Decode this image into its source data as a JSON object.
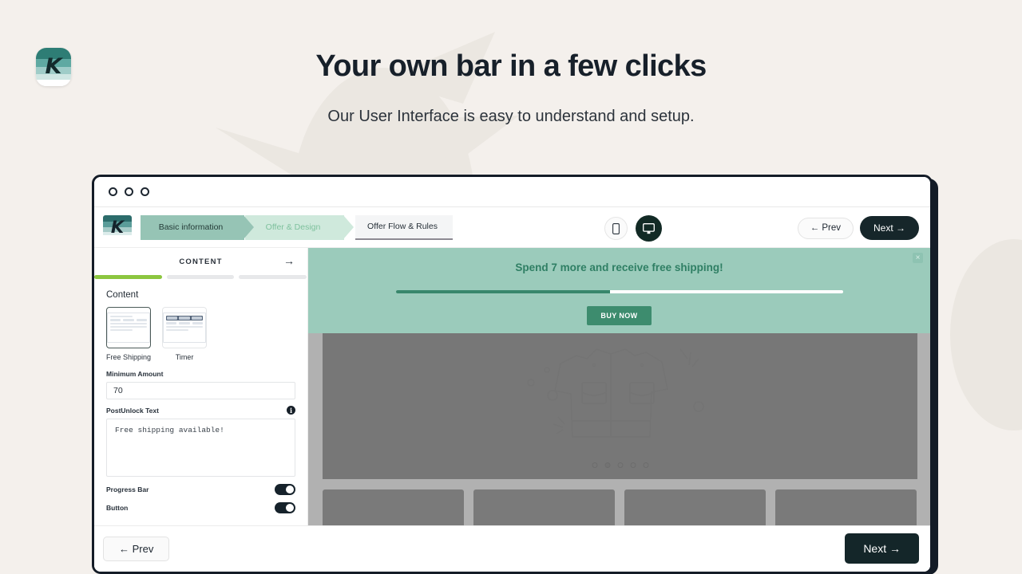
{
  "hero": {
    "title": "Your own bar in a few clicks",
    "subtitle": "Our User Interface is easy to understand and setup.",
    "logo_letter": "K",
    "logo_name": "brand-logo"
  },
  "window": {
    "titlebar_dots": 3
  },
  "toolbar": {
    "logo_letter": "K",
    "steps": [
      {
        "label": "Basic information",
        "state": "done"
      },
      {
        "label": "Offer & Design",
        "state": "active"
      },
      {
        "label": "Offer Flow & Rules",
        "state": "todo"
      }
    ],
    "devices": [
      {
        "name": "mobile",
        "selected": false
      },
      {
        "name": "desktop",
        "selected": true
      }
    ],
    "prev_label": "← Prev",
    "next_label": "Next →"
  },
  "sidebar": {
    "header": "CONTENT",
    "header_arrow": "→",
    "progress_segments": 3,
    "progress_filled": 1,
    "section_label": "Content",
    "options": [
      {
        "label": "Free Shipping",
        "selected": true
      },
      {
        "label": "Timer",
        "selected": false
      }
    ],
    "fields": [
      {
        "label": "Minimum Amount",
        "value": "70",
        "type": "input"
      },
      {
        "label": "PostUnlock Text",
        "value": "Free shipping available!",
        "type": "textarea",
        "info_icon": "i"
      }
    ],
    "toggles": [
      {
        "label": "Progress Bar",
        "on": true
      },
      {
        "label": "Button",
        "on": true
      }
    ]
  },
  "preview": {
    "promo": {
      "message": "Spend 7 more and receive free shipping!",
      "progress_percent": 48,
      "cta_label": "BUY NOW",
      "close_label": "×"
    },
    "carousel": {
      "dots": 5,
      "active_index": 1
    },
    "product_cards": 4
  },
  "footer": {
    "prev_label": "← Prev",
    "next_label": "Next →"
  },
  "colors": {
    "page_bg": "#f4f0ec",
    "dark": "#142629",
    "promo_bg": "#9bcbbb",
    "promo_text": "#2f7f64",
    "promo_fill": "#38876c",
    "progress_green": "#8cc63f",
    "step_done": "#96c4b5",
    "step_active": "#cfe9dc"
  }
}
